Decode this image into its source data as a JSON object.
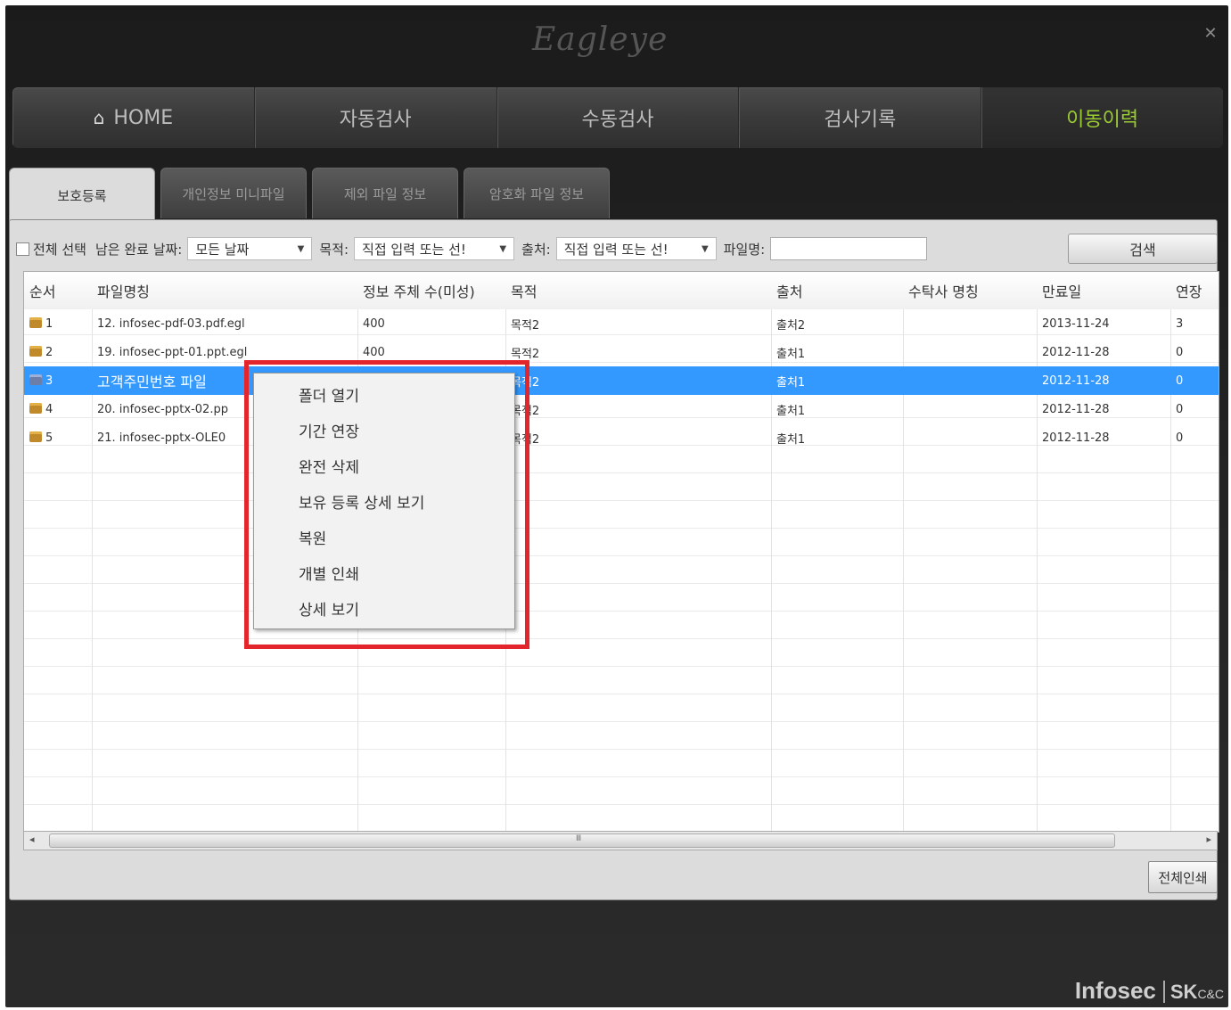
{
  "window": {
    "logo_prefix": "",
    "logo_text": "Eagleye",
    "close_label": "✕"
  },
  "nav": {
    "home": "HOME",
    "auto_scan": "자동검사",
    "manual_scan": "수동검사",
    "scan_history": "검사기록",
    "move_history": "이동이력"
  },
  "tabs": [
    "보호등록",
    "개인정보 미니파일",
    "제외 파일 정보",
    "암호화 파일 정보"
  ],
  "filter": {
    "select_all": "전체 선택",
    "remaining_label": "남은 완료 날짜:",
    "date_value": "모든 날짜",
    "purpose_label": "목적:",
    "purpose_value": "직접 입력 또는 선!",
    "source_label": "출처:",
    "source_value": "직접 입력 또는 선!",
    "filename_label": "파일명:",
    "filename_value": "",
    "search_button": "검색"
  },
  "table": {
    "columns": [
      "순서",
      "파일명칭",
      "정보 주체 수(미성)",
      "목적",
      "출처",
      "수탁사 명칭",
      "만료일",
      "연장"
    ],
    "rows": [
      {
        "num": "1",
        "file": "12. infosec-pdf-03.pdf.egl",
        "count": "400",
        "purpose": "목적2",
        "source": "출처2",
        "trustee": "",
        "expire": "2013-11-24",
        "ext": "3"
      },
      {
        "num": "2",
        "file": "19. infosec-ppt-01.ppt.egl",
        "count": "400",
        "purpose": "목적2",
        "source": "출처1",
        "trustee": "",
        "expire": "2012-11-28",
        "ext": "0"
      },
      {
        "num": "3",
        "file": "고객주민번호 파일",
        "count": "",
        "purpose": "목적2",
        "source": "출처1",
        "trustee": "",
        "expire": "2012-11-28",
        "ext": "0"
      },
      {
        "num": "4",
        "file": "20. infosec-pptx-02.pp",
        "count": "",
        "purpose": "목적2",
        "source": "출처1",
        "trustee": "",
        "expire": "2012-11-28",
        "ext": "0"
      },
      {
        "num": "5",
        "file": "21. infosec-pptx-OLE0",
        "count": "",
        "purpose": "목적2",
        "source": "출처1",
        "trustee": "",
        "expire": "2012-11-28",
        "ext": "0"
      }
    ],
    "selected_row": 3
  },
  "context_menu": [
    "폴더 열기",
    "기간 연장",
    "완전 삭제",
    "보유 등록 상세 보기",
    "복원",
    "개별 인쇄",
    "상세 보기"
  ],
  "scrollbar": {
    "left": "◂",
    "right": "▸",
    "grip": "Ⅲ"
  },
  "print_all_button": "전체인쇄",
  "brand": {
    "name": "Infosec",
    "sk": "SK",
    "cc": "C&C"
  }
}
